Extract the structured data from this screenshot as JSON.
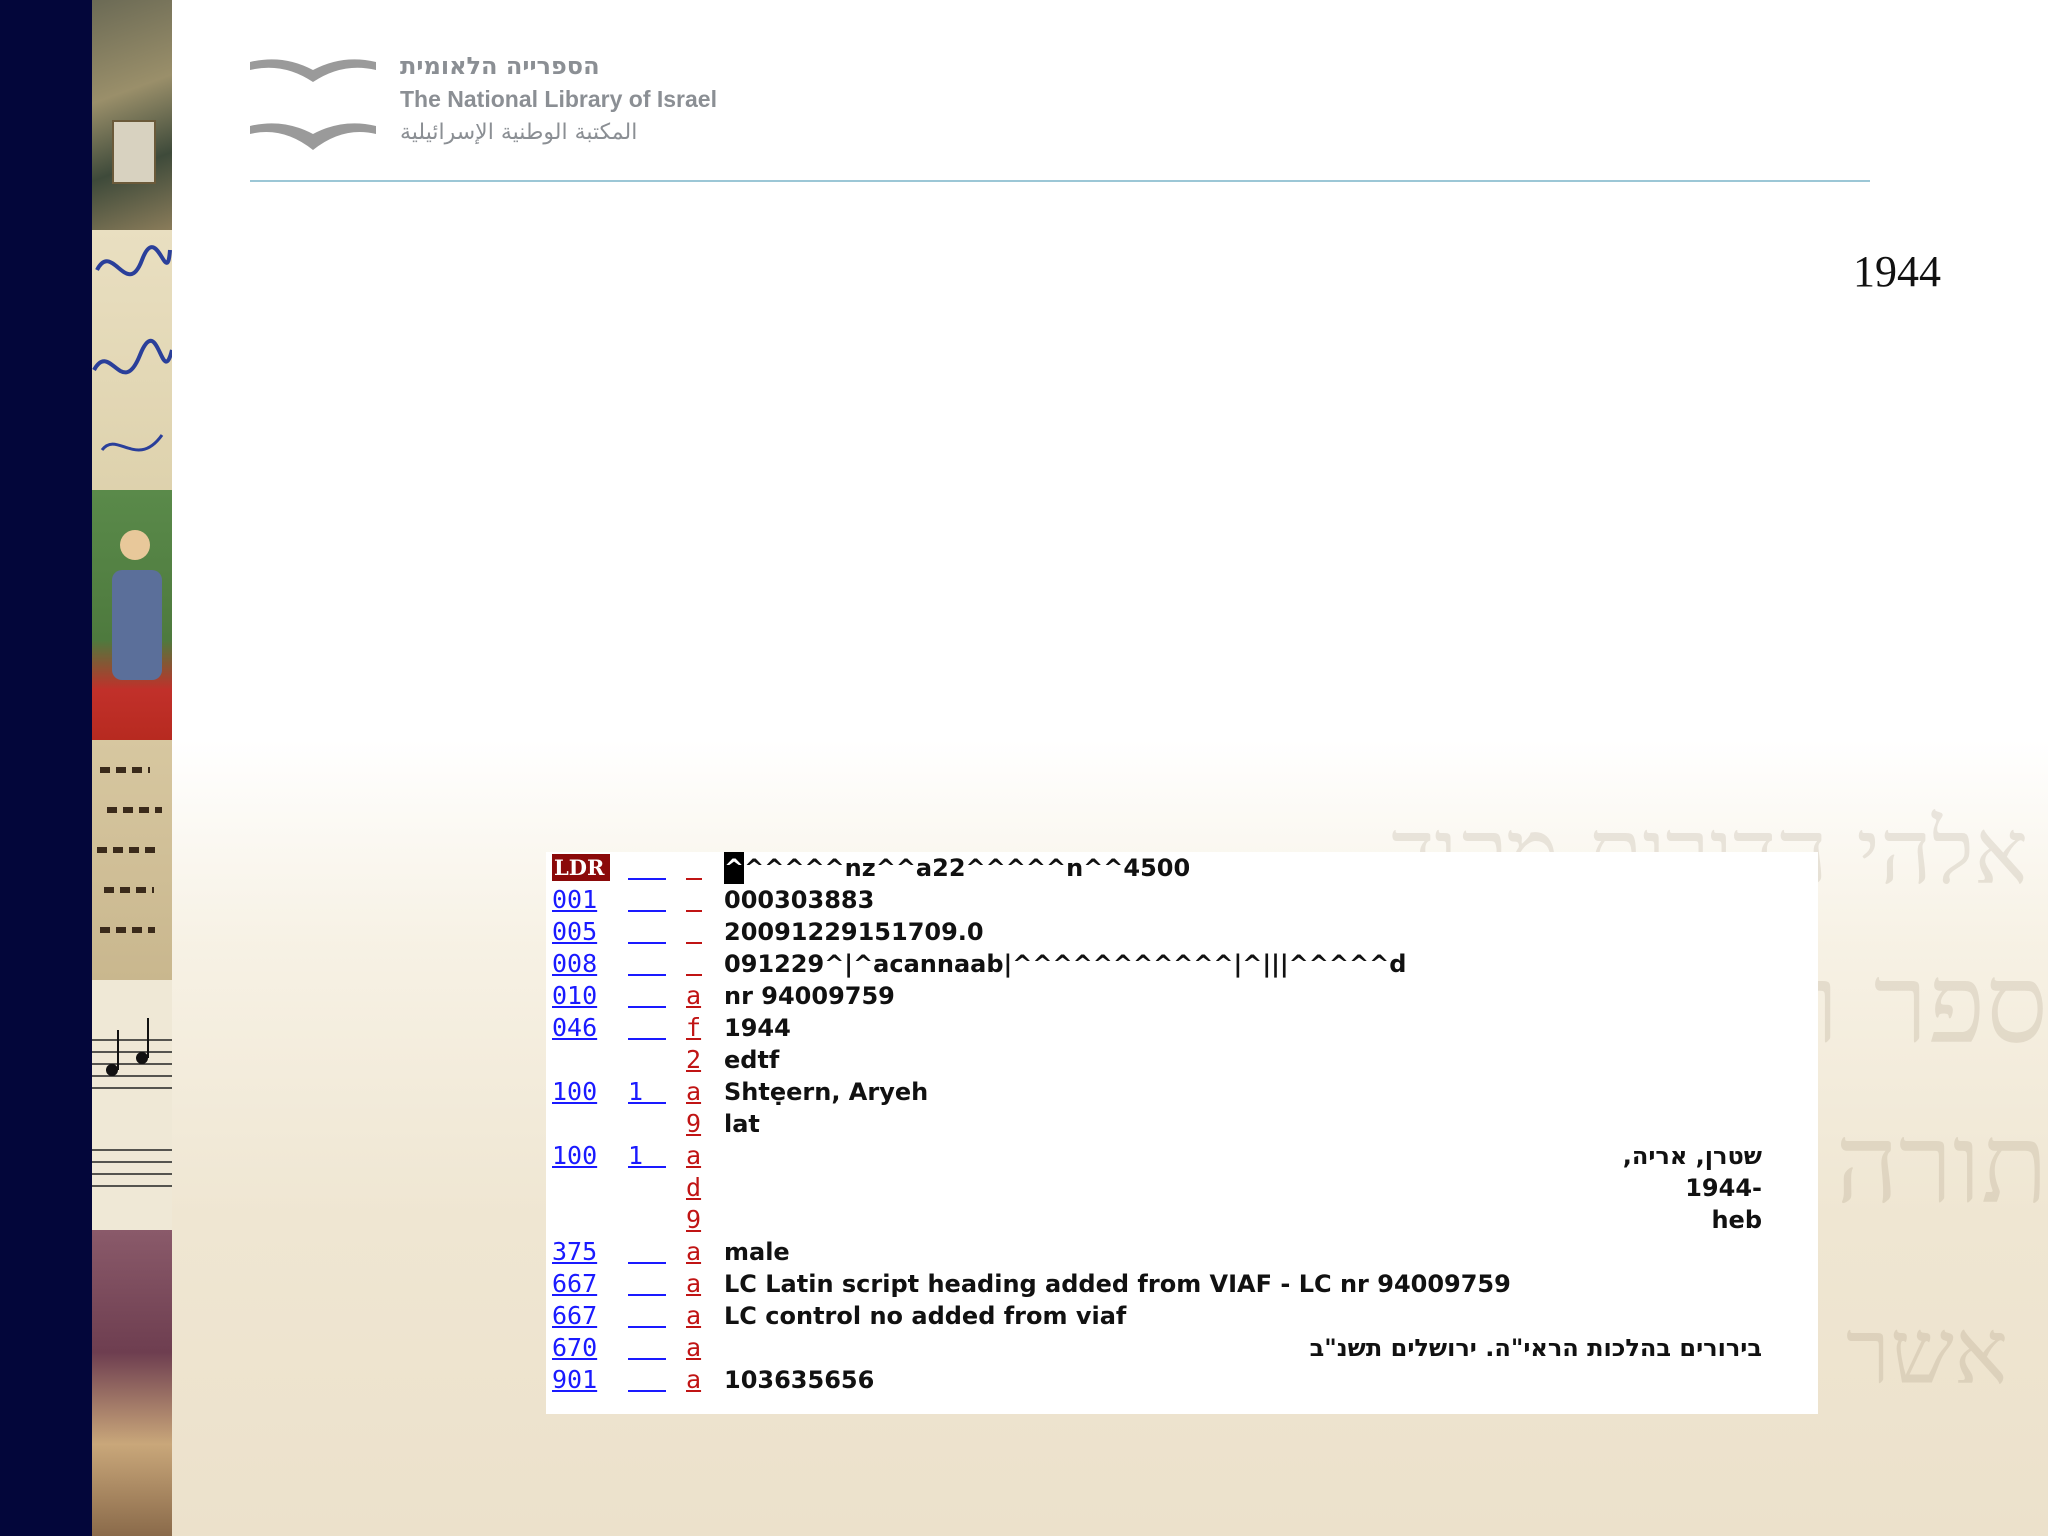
{
  "header": {
    "logo_hebrew": "הספרייה הלאומית",
    "logo_english": "The National Library of Israel",
    "logo_arabic": "المكتبة الوطنية الإسرائيلية",
    "logo_icon": "open-book-icon"
  },
  "slide": {
    "title": "1944"
  },
  "marc_record": {
    "rows": [
      {
        "tag": "LDR",
        "ind": "",
        "sub": "",
        "value": "^^^^^nz^^a22^^^^^n^^4500"
      },
      {
        "tag": "001",
        "ind": "",
        "sub": "",
        "value": "000303883"
      },
      {
        "tag": "005",
        "ind": "",
        "sub": "",
        "value": "20091229151709.0"
      },
      {
        "tag": "008",
        "ind": "",
        "sub": "",
        "value": "091229^|^acannaab|^^^^^^^^^^^|^|||^^^^^d"
      },
      {
        "tag": "010",
        "ind": "",
        "sub": "a",
        "value": "nr 94009759"
      },
      {
        "tag": "046",
        "ind": "",
        "sub": "f",
        "value": "1944"
      },
      {
        "tag": "",
        "ind": "",
        "sub": "2",
        "value": "edtf"
      },
      {
        "tag": "100",
        "ind": "1",
        "sub": "a",
        "value": "Shtẹern, Aryeh"
      },
      {
        "tag": "",
        "ind": "",
        "sub": "9",
        "value": "lat"
      },
      {
        "tag": "100",
        "ind": "1",
        "sub": "a",
        "value": "שטרן, אריה,"
      },
      {
        "tag": "",
        "ind": "",
        "sub": "d",
        "value": "1944-"
      },
      {
        "tag": "",
        "ind": "",
        "sub": "9",
        "value": "heb"
      },
      {
        "tag": "375",
        "ind": "",
        "sub": "a",
        "value": "male"
      },
      {
        "tag": "667",
        "ind": "",
        "sub": "a",
        "value": "LC Latin script heading added from VIAF - LC nr 94009759"
      },
      {
        "tag": "667",
        "ind": "",
        "sub": "a",
        "value": "LC control no added from viaf"
      },
      {
        "tag": "670",
        "ind": "",
        "sub": "a",
        "value": "בירורים בהלכות הראי\"ה. ירושלים תשנ\"ב"
      },
      {
        "tag": "901",
        "ind": "",
        "sub": "a",
        "value": "103635656"
      }
    ]
  },
  "colors": {
    "tag_blue": "#1a1aff",
    "subfield_red": "#c01414",
    "ldr_background": "#8b0a0a",
    "left_band_navy": "#03063a",
    "header_rule": "#9cc7d6"
  }
}
